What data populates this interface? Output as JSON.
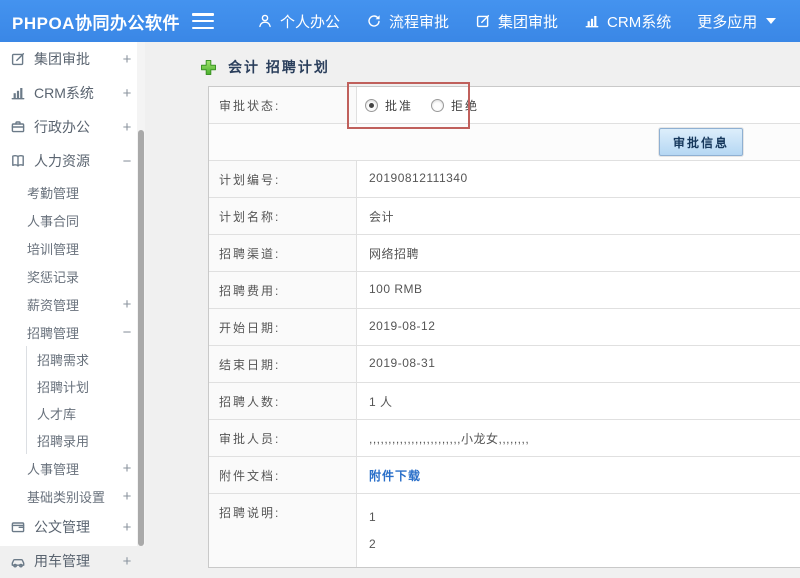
{
  "topbar": {
    "title": "PHPOA协同办公软件",
    "items": [
      {
        "label": "个人办公",
        "icon": "person-icon"
      },
      {
        "label": "流程审批",
        "icon": "cycle-icon"
      },
      {
        "label": "集团审批",
        "icon": "edit-icon"
      },
      {
        "label": "CRM系统",
        "icon": "bar-chart-icon"
      },
      {
        "label": "更多应用",
        "icon": "",
        "caret": true
      }
    ]
  },
  "sidebar": {
    "items": [
      {
        "label": "集团审批",
        "icon": "edit-icon",
        "toggle": "+",
        "level": 0
      },
      {
        "label": "CRM系统",
        "icon": "bar-chart-icon",
        "toggle": "+",
        "level": 0
      },
      {
        "label": "行政办公",
        "icon": "briefcase-icon",
        "toggle": "+",
        "level": 0
      },
      {
        "label": "人力资源",
        "icon": "book-icon",
        "toggle": "−",
        "level": 0
      },
      {
        "label": "考勤管理",
        "icon": "",
        "toggle": "",
        "level": 1
      },
      {
        "label": "人事合同",
        "icon": "",
        "toggle": "",
        "level": 1
      },
      {
        "label": "培训管理",
        "icon": "",
        "toggle": "",
        "level": 1
      },
      {
        "label": "奖惩记录",
        "icon": "",
        "toggle": "",
        "level": 1
      },
      {
        "label": "薪资管理",
        "icon": "",
        "toggle": "+",
        "level": 1
      },
      {
        "label": "招聘管理",
        "icon": "",
        "toggle": "−",
        "level": 1
      },
      {
        "label": "招聘需求",
        "icon": "",
        "toggle": "",
        "level": 2
      },
      {
        "label": "招聘计划",
        "icon": "",
        "toggle": "",
        "level": 2
      },
      {
        "label": "人才库",
        "icon": "",
        "toggle": "",
        "level": 2
      },
      {
        "label": "招聘录用",
        "icon": "",
        "toggle": "",
        "level": 2
      },
      {
        "label": "人事管理",
        "icon": "",
        "toggle": "+",
        "level": 1
      },
      {
        "label": "基础类别设置",
        "icon": "",
        "toggle": "+",
        "level": 1
      },
      {
        "label": "公文管理",
        "icon": "wallet-icon",
        "toggle": "+",
        "level": 0
      },
      {
        "label": "用车管理",
        "icon": "car-icon",
        "toggle": "+",
        "level": 0
      }
    ]
  },
  "main": {
    "page_title": "会计 招聘计划",
    "form": {
      "rows": [
        {
          "type": "radio",
          "label": "审批状态:",
          "options": [
            {
              "label": "批准",
              "checked": true
            },
            {
              "label": "拒绝",
              "checked": false
            }
          ]
        },
        {
          "type": "button",
          "button_label": "审批信息"
        },
        {
          "type": "text",
          "label": "计划编号:",
          "value": "20190812111340"
        },
        {
          "type": "text",
          "label": "计划名称:",
          "value": "会计"
        },
        {
          "type": "text",
          "label": "招聘渠道:",
          "value": "网络招聘"
        },
        {
          "type": "text",
          "label": "招聘费用:",
          "value": "100 RMB"
        },
        {
          "type": "text",
          "label": "开始日期:",
          "value": "2019-08-12"
        },
        {
          "type": "text",
          "label": "结束日期:",
          "value": "2019-08-31"
        },
        {
          "type": "text",
          "label": "招聘人数:",
          "value": "1 人"
        },
        {
          "type": "text",
          "label": "审批人员:",
          "value": ",,,,,,,,,,,,,,,,,,,,,,,,小龙女,,,,,,,,"
        },
        {
          "type": "link",
          "label": "附件文档:",
          "value": "附件下载"
        },
        {
          "type": "multiline",
          "label": "招聘说明:",
          "lines": [
            "1",
            "2"
          ]
        }
      ]
    }
  },
  "colors": {
    "topbar_blue": "#3d8ceb",
    "highlight_red": "#c0605c",
    "link_blue": "#2a6fc9",
    "button_face": "#c7e0f7",
    "button_text": "#16385c",
    "main_bg": "#f0f0f0"
  }
}
